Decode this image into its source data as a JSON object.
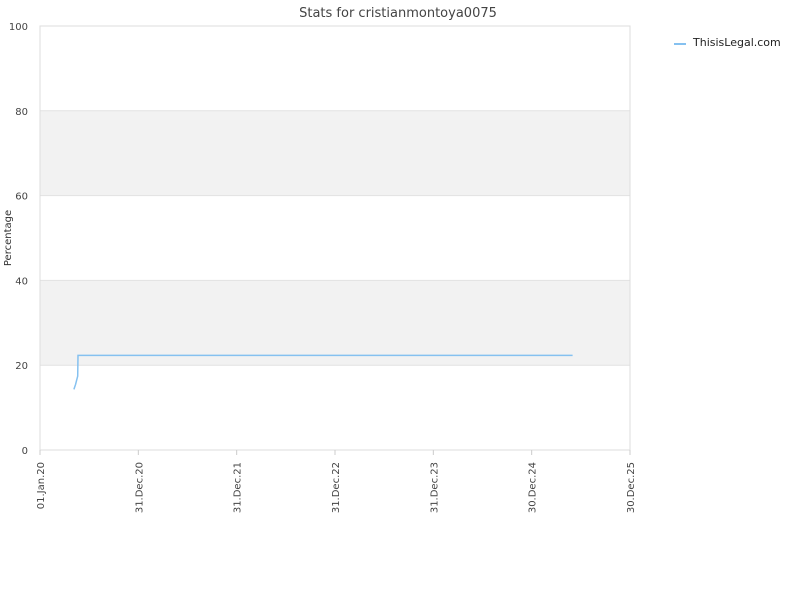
{
  "chart_data": {
    "type": "line",
    "title": "Stats for cristianmontoya0075",
    "xlabel": "",
    "ylabel": "Percentage",
    "ylim": [
      0,
      100
    ],
    "yticks": [
      0,
      20,
      40,
      60,
      80,
      100
    ],
    "xlim": [
      "2020-01-01",
      "2025-12-30"
    ],
    "xticks": [
      {
        "date": "2020-01-01",
        "label": "01.Jan.20"
      },
      {
        "date": "2020-12-31",
        "label": "31.Dec.20"
      },
      {
        "date": "2021-12-31",
        "label": "31.Dec.21"
      },
      {
        "date": "2022-12-31",
        "label": "31.Dec.22"
      },
      {
        "date": "2023-12-31",
        "label": "31.Dec.23"
      },
      {
        "date": "2024-12-30",
        "label": "30.Dec.24"
      },
      {
        "date": "2025-12-30",
        "label": "30.Dec.25"
      }
    ],
    "grid": true,
    "banded_background": true,
    "legend_position": "top-right",
    "series": [
      {
        "name": "ThisisLegal.com",
        "color": "#85c1f0",
        "points": [
          {
            "x": "2020-05-06",
            "y": 14.3
          },
          {
            "x": "2020-05-12",
            "y": 15.5
          },
          {
            "x": "2020-05-17",
            "y": 16.7
          },
          {
            "x": "2020-05-20",
            "y": 17.4
          },
          {
            "x": "2020-05-21",
            "y": 22.3
          },
          {
            "x": "2025-05-31",
            "y": 22.3
          }
        ]
      }
    ]
  }
}
